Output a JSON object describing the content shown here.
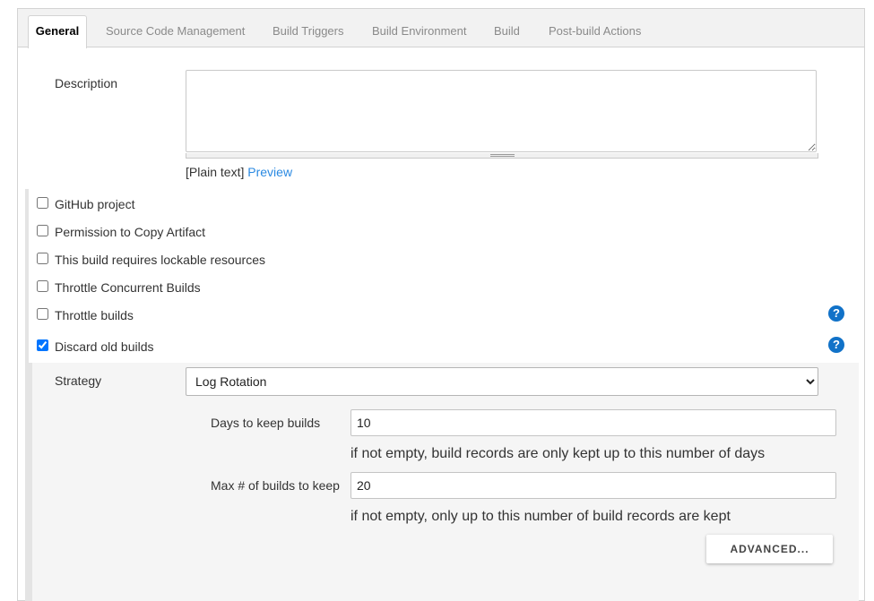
{
  "tabs": [
    {
      "label": "General",
      "active": true
    },
    {
      "label": "Source Code Management",
      "active": false
    },
    {
      "label": "Build Triggers",
      "active": false
    },
    {
      "label": "Build Environment",
      "active": false
    },
    {
      "label": "Build",
      "active": false
    },
    {
      "label": "Post-build Actions",
      "active": false
    }
  ],
  "description": {
    "label": "Description",
    "value": "",
    "format_note": "[Plain text]",
    "preview_link": "Preview"
  },
  "options": [
    {
      "label": "GitHub project",
      "checked": false,
      "help": false
    },
    {
      "label": "Permission to Copy Artifact",
      "checked": false,
      "help": false
    },
    {
      "label": "This build requires lockable resources",
      "checked": false,
      "help": false
    },
    {
      "label": "Throttle Concurrent Builds",
      "checked": false,
      "help": false
    },
    {
      "label": "Throttle builds",
      "checked": false,
      "help": true
    },
    {
      "label": "Discard old builds",
      "checked": true,
      "help": true
    }
  ],
  "help_glyph": "?",
  "discard": {
    "strategy_label": "Strategy",
    "strategy_value": "Log Rotation",
    "days_label": "Days to keep builds",
    "days_value": "10",
    "days_hint": "if not empty, build records are only kept up to this number of days",
    "max_label": "Max # of builds to keep",
    "max_value": "20",
    "max_hint": "if not empty, only up to this number of build records are kept",
    "advanced_label": "ADVANCED..."
  },
  "colors": {
    "link": "#2b8ae2",
    "help": "#1172c8",
    "checkbox_checked": "#1a73e8"
  }
}
